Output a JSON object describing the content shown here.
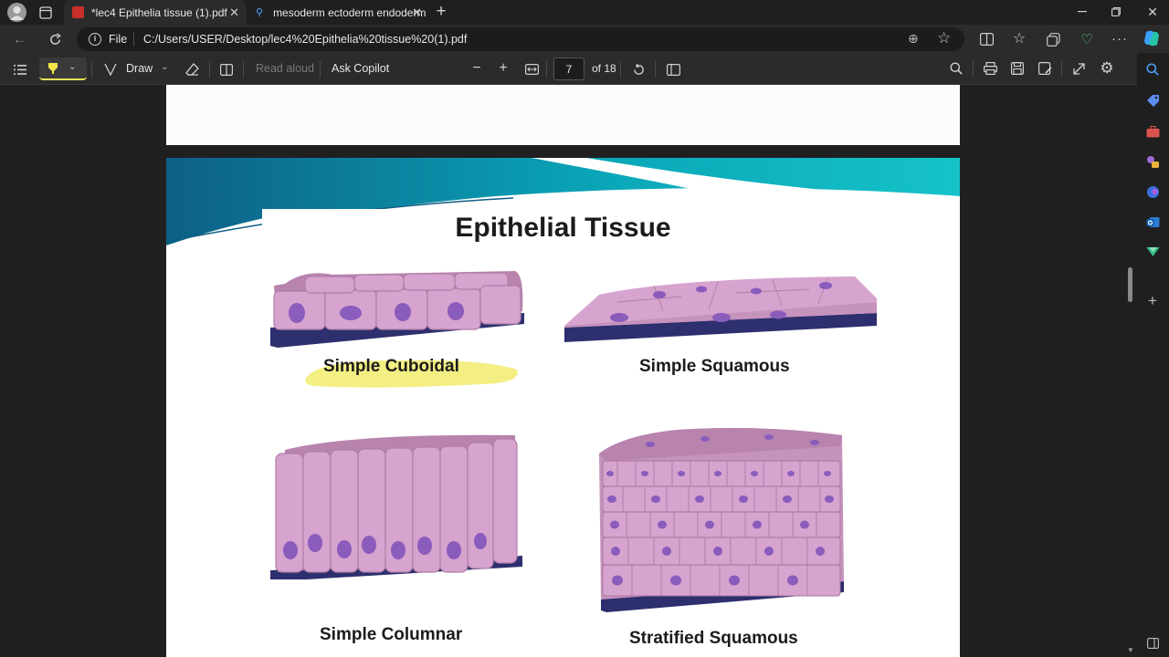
{
  "tabs": [
    {
      "label": "*lec4 Epithelia tissue (1).pdf",
      "icon": "pdf-icon",
      "active": true
    },
    {
      "label": "mesoderm ectoderm endoderm",
      "icon": "search-icon",
      "active": false
    }
  ],
  "address": {
    "scheme_label": "File",
    "url": "C:/Users/USER/Desktop/lec4%20Epithelia%20tissue%20(1).pdf"
  },
  "pdf_toolbar": {
    "draw_label": "Draw",
    "read_aloud_label": "Read aloud",
    "ask_copilot_label": "Ask Copilot",
    "page_number": "7",
    "page_total": "of 18"
  },
  "slide": {
    "title": "Epithelial Tissue",
    "captions": {
      "cuboidal": "Simple Cuboidal",
      "squamous": "Simple Squamous",
      "columnar": "Simple Columnar",
      "stratified": "Stratified Squamous"
    }
  },
  "colors": {
    "accent": "#0aa6b8",
    "cell": "#d7a3cf",
    "cell_dark": "#b883ad",
    "nucleus": "#8a5cbb",
    "basement": "#2d2f6e",
    "highlight": "#f3ef83"
  }
}
